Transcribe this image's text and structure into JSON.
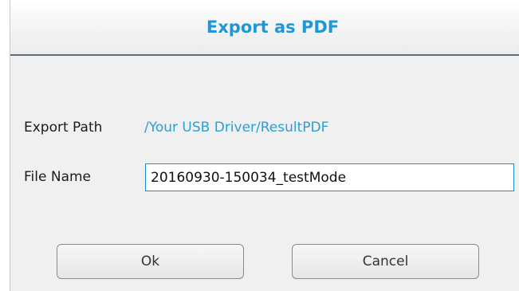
{
  "dialog": {
    "title": "Export as PDF",
    "export_path_label": "Export Path",
    "export_path_value": "/Your USB Driver/ResultPDF",
    "file_name_label": "File Name",
    "file_name_value": "20160930-150034_testMode",
    "ok_label": "Ok",
    "cancel_label": "Cancel"
  },
  "colors": {
    "title": "#1d97d6",
    "path_value": "#2a9fd8",
    "input_border": "#1a8fd0"
  }
}
